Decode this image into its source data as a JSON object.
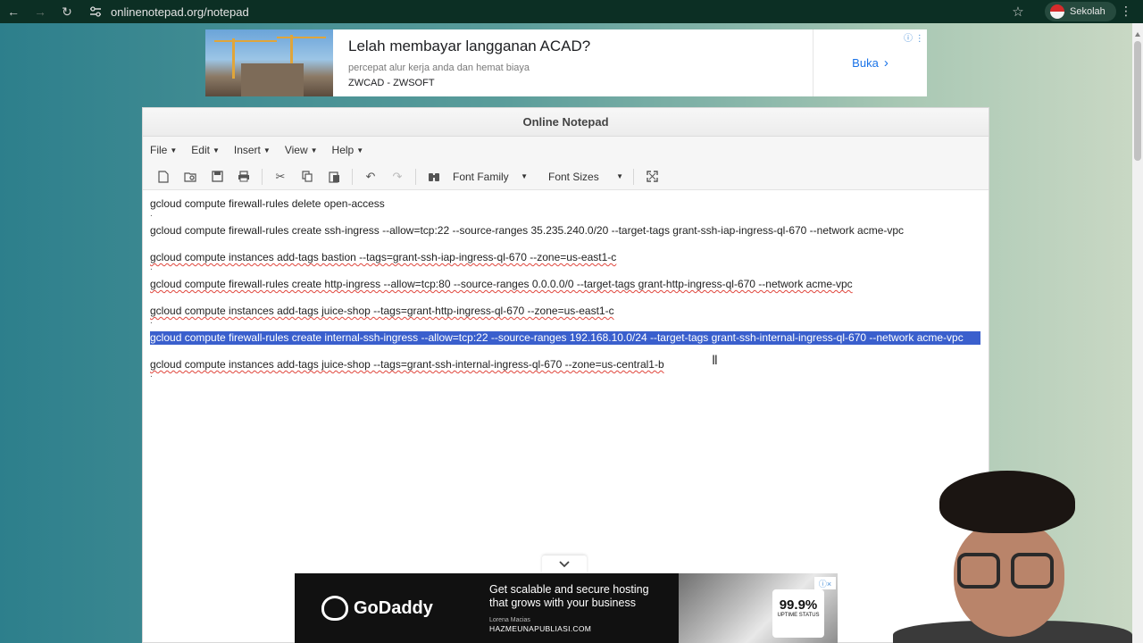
{
  "browser": {
    "url": "onlinenotepad.org/notepad",
    "profile_label": "Sekolah"
  },
  "ad_top": {
    "headline": "Lelah membayar langganan ACAD?",
    "subtitle": "percepat alur kerja anda dan hemat biaya",
    "brand": "ZWCAD - ZWSOFT",
    "cta": "Buka"
  },
  "notepad": {
    "title": "Online Notepad",
    "menu": [
      "File",
      "Edit",
      "Insert",
      "View",
      "Help"
    ],
    "toolbar": {
      "font_family": "Font Family",
      "font_sizes": "Font Sizes"
    },
    "lines": [
      "gcloud compute firewall-rules delete open-access",
      "gcloud compute firewall-rules create ssh-ingress --allow=tcp:22 --source-ranges 35.235.240.0/20 --target-tags grant-ssh-iap-ingress-ql-670 --network acme-vpc",
      "gcloud compute instances add-tags bastion --tags=grant-ssh-iap-ingress-ql-670 --zone=us-east1-c",
      "gcloud compute firewall-rules create http-ingress --allow=tcp:80 --source-ranges 0.0.0.0/0 --target-tags grant-http-ingress-ql-670 --network acme-vpc",
      "gcloud compute instances add-tags juice-shop --tags=grant-http-ingress-ql-670 --zone=us-east1-c",
      "gcloud compute firewall-rules create internal-ssh-ingress --allow=tcp:22 --source-ranges 192.168.10.0/24 --target-tags grant-ssh-internal-ingress-ql-670 --network acme-vpc",
      "gcloud compute instances add-tags juice-shop --tags=grant-ssh-internal-ingress-ql-670 --zone=us-central1-b"
    ],
    "separator": "."
  },
  "ad_bottom": {
    "brand": "GoDaddy",
    "copy": "Get scalable and secure hosting that grows with your business",
    "person_name": "Lorena Macias",
    "domain": "HAZMEUNAPUBLIASI.COM",
    "badge_value": "99.9%",
    "badge_label": "UPTIME STATUS"
  }
}
